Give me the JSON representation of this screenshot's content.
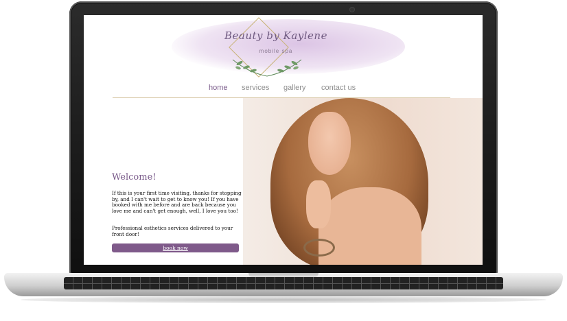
{
  "logo": {
    "title": "Beauty by Kaylene",
    "subtitle": "mobile spa"
  },
  "nav": {
    "items": [
      {
        "label": "home",
        "active": true
      },
      {
        "label": "services",
        "active": false
      },
      {
        "label": "gallery",
        "active": false
      },
      {
        "label": "contact us",
        "active": false
      }
    ]
  },
  "welcome": {
    "title": "Welcome!",
    "paragraph1": "If this is your first time visiting, thanks for stopping by, and I can't wait to get to know you! If you have booked with me before and are back because you love me and can't get enough, well, I love you too!",
    "paragraph2": "Professional esthetics services delivered to your front door!",
    "button": "book now"
  },
  "colors": {
    "accent": "#7f5a8a",
    "nav_active": "#7a5b8a",
    "nav_inactive": "#8d8d8d",
    "brush": "#dcc3e6"
  },
  "hero_image": "smiling woman with long wavy hair"
}
